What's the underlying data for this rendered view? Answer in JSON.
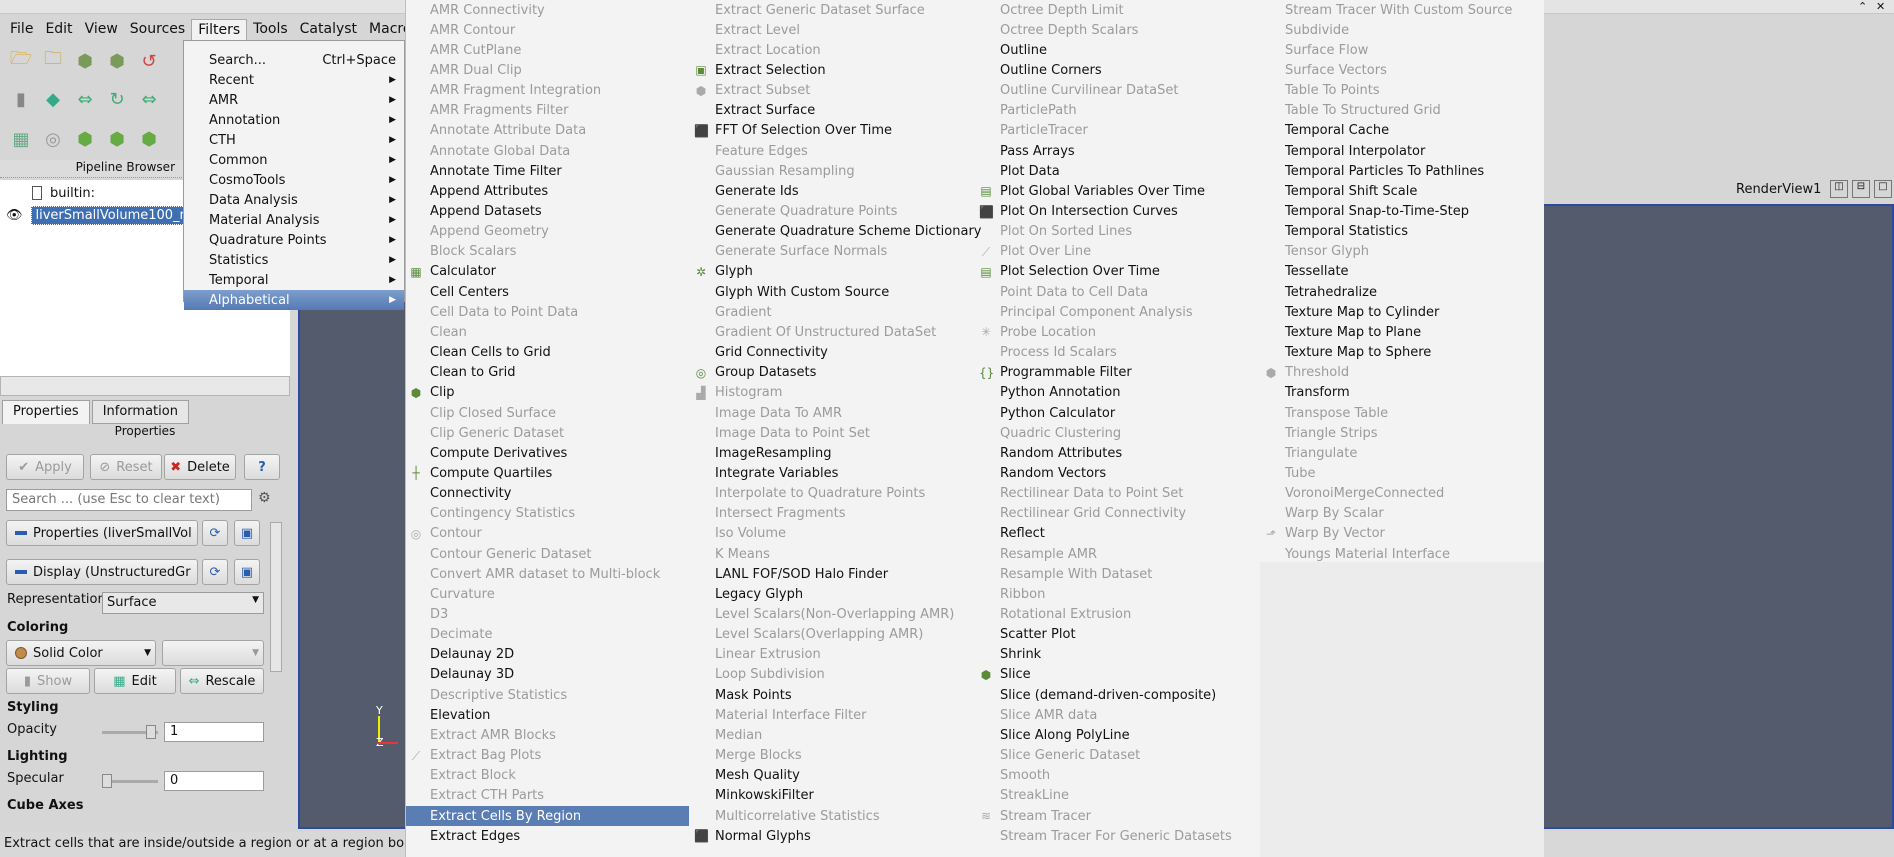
{
  "menubar": {
    "items": [
      "File",
      "Edit",
      "View",
      "Sources",
      "Filters",
      "Tools",
      "Catalyst",
      "Macros"
    ],
    "active": "Filters"
  },
  "pipeline": {
    "header": "Pipeline Browser",
    "builtin": "builtin:",
    "source": "liverSmallVolume100_n"
  },
  "properties": {
    "tabs": [
      "Properties",
      "Information"
    ],
    "title": "Properties",
    "apply": "Apply",
    "reset": "Reset",
    "delete": "Delete",
    "help": "?",
    "search_placeholder": "Search ... (use Esc to clear text)",
    "section_props": "Properties (liverSmallVol",
    "section_display": "Display (UnstructuredGr",
    "representation_label": "Representation",
    "representation_value": "Surface",
    "coloring": "Coloring",
    "solid_color": "Solid Color",
    "show": "Show",
    "edit": "Edit",
    "rescale": "Rescale",
    "styling": "Styling",
    "opacity_label": "Opacity",
    "opacity_value": "1",
    "lighting": "Lighting",
    "specular_label": "Specular",
    "specular_value": "0",
    "cube_axes": "Cube Axes"
  },
  "renderview": {
    "title": "RenderView1",
    "axis_y": "Y",
    "axis_z": "Z"
  },
  "status": "Extract cells that are inside/outside a region or at a region bounda",
  "filters_menu": [
    {
      "label": "Search...",
      "shortcut": "Ctrl+Space",
      "sub": false
    },
    {
      "label": "Recent",
      "sub": true
    },
    {
      "label": "AMR",
      "sub": true
    },
    {
      "label": "Annotation",
      "sub": true
    },
    {
      "label": "CTH",
      "sub": true
    },
    {
      "label": "Common",
      "sub": true
    },
    {
      "label": "CosmoTools",
      "sub": true
    },
    {
      "label": "Data Analysis",
      "sub": true
    },
    {
      "label": "Material Analysis",
      "sub": true
    },
    {
      "label": "Quadrature Points",
      "sub": true
    },
    {
      "label": "Statistics",
      "sub": true
    },
    {
      "label": "Temporal",
      "sub": true
    },
    {
      "label": "Alphabetical",
      "sub": true,
      "selected": true
    }
  ],
  "alphabetical": {
    "col1": [
      {
        "t": "AMR Connectivity",
        "e": false
      },
      {
        "t": "AMR Contour",
        "e": false
      },
      {
        "t": "AMR CutPlane",
        "e": false
      },
      {
        "t": "AMR Dual Clip",
        "e": false
      },
      {
        "t": "AMR Fragment Integration",
        "e": false
      },
      {
        "t": "AMR Fragments Filter",
        "e": false
      },
      {
        "t": "Annotate Attribute Data",
        "e": false
      },
      {
        "t": "Annotate Global Data",
        "e": false
      },
      {
        "t": "Annotate Time Filter",
        "e": true
      },
      {
        "t": "Append Attributes",
        "e": true
      },
      {
        "t": "Append Datasets",
        "e": true
      },
      {
        "t": "Append Geometry",
        "e": false
      },
      {
        "t": "Block Scalars",
        "e": false
      },
      {
        "t": "Calculator",
        "e": true,
        "icon": "calculator-icon"
      },
      {
        "t": "Cell Centers",
        "e": true
      },
      {
        "t": "Cell Data to Point Data",
        "e": false
      },
      {
        "t": "Clean",
        "e": false
      },
      {
        "t": "Clean Cells to Grid",
        "e": true
      },
      {
        "t": "Clean to Grid",
        "e": true
      },
      {
        "t": "Clip",
        "e": true,
        "icon": "clip-icon"
      },
      {
        "t": "Clip Closed Surface",
        "e": false
      },
      {
        "t": "Clip Generic Dataset",
        "e": false
      },
      {
        "t": "Compute Derivatives",
        "e": true
      },
      {
        "t": "Compute Quartiles",
        "e": true,
        "icon": "quartiles-icon"
      },
      {
        "t": "Connectivity",
        "e": true
      },
      {
        "t": "Contingency Statistics",
        "e": false
      },
      {
        "t": "Contour",
        "e": false,
        "icon": "contour-icon"
      },
      {
        "t": "Contour Generic Dataset",
        "e": false
      },
      {
        "t": "Convert AMR dataset to Multi-block",
        "e": false
      },
      {
        "t": "Curvature",
        "e": false
      },
      {
        "t": "D3",
        "e": false
      },
      {
        "t": "Decimate",
        "e": false
      },
      {
        "t": "Delaunay 2D",
        "e": true
      },
      {
        "t": "Delaunay 3D",
        "e": true
      },
      {
        "t": "Descriptive Statistics",
        "e": false
      },
      {
        "t": "Elevation",
        "e": true
      },
      {
        "t": "Extract AMR Blocks",
        "e": false
      },
      {
        "t": "Extract Bag Plots",
        "e": false,
        "icon": "bag-plot-icon"
      },
      {
        "t": "Extract Block",
        "e": false
      },
      {
        "t": "Extract CTH Parts",
        "e": false
      },
      {
        "t": "Extract Cells By Region",
        "e": true,
        "selected": true
      },
      {
        "t": "Extract Edges",
        "e": true
      }
    ],
    "col2": [
      {
        "t": "Extract Generic Dataset Surface",
        "e": false
      },
      {
        "t": "Extract Level",
        "e": false
      },
      {
        "t": "Extract Location",
        "e": false
      },
      {
        "t": "Extract Selection",
        "e": true,
        "icon": "extract-selection-icon"
      },
      {
        "t": "Extract Subset",
        "e": false,
        "icon": "extract-subset-icon"
      },
      {
        "t": "Extract Surface",
        "e": true
      },
      {
        "t": "FFT Of Selection Over Time",
        "e": true,
        "icon": "fft-icon"
      },
      {
        "t": "Feature Edges",
        "e": false
      },
      {
        "t": "Gaussian Resampling",
        "e": false
      },
      {
        "t": "Generate Ids",
        "e": true
      },
      {
        "t": "Generate Quadrature Points",
        "e": false
      },
      {
        "t": "Generate Quadrature Scheme Dictionary",
        "e": true
      },
      {
        "t": "Generate Surface Normals",
        "e": false
      },
      {
        "t": "Glyph",
        "e": true,
        "icon": "glyph-icon"
      },
      {
        "t": "Glyph With Custom Source",
        "e": true
      },
      {
        "t": "Gradient",
        "e": false
      },
      {
        "t": "Gradient Of Unstructured DataSet",
        "e": false
      },
      {
        "t": "Grid Connectivity",
        "e": true
      },
      {
        "t": "Group Datasets",
        "e": true,
        "icon": "group-icon"
      },
      {
        "t": "Histogram",
        "e": false,
        "icon": "histogram-icon"
      },
      {
        "t": "Image Data To AMR",
        "e": false
      },
      {
        "t": "Image Data to Point Set",
        "e": false
      },
      {
        "t": "ImageResampling",
        "e": true
      },
      {
        "t": "Integrate Variables",
        "e": true
      },
      {
        "t": "Interpolate to Quadrature Points",
        "e": false
      },
      {
        "t": "Intersect Fragments",
        "e": false
      },
      {
        "t": "Iso Volume",
        "e": false
      },
      {
        "t": "K Means",
        "e": false
      },
      {
        "t": "LANL FOF/SOD Halo Finder",
        "e": true
      },
      {
        "t": "Legacy Glyph",
        "e": true
      },
      {
        "t": "Level Scalars(Non-Overlapping AMR)",
        "e": false
      },
      {
        "t": "Level Scalars(Overlapping AMR)",
        "e": false
      },
      {
        "t": "Linear Extrusion",
        "e": false
      },
      {
        "t": "Loop Subdivision",
        "e": false
      },
      {
        "t": "Mask Points",
        "e": true
      },
      {
        "t": "Material Interface Filter",
        "e": false
      },
      {
        "t": "Median",
        "e": false
      },
      {
        "t": "Merge Blocks",
        "e": false
      },
      {
        "t": "Mesh Quality",
        "e": true
      },
      {
        "t": "MinkowskiFilter",
        "e": true
      },
      {
        "t": "Multicorrelative Statistics",
        "e": false
      },
      {
        "t": "Normal Glyphs",
        "e": true,
        "icon": "normal-glyphs-icon"
      }
    ],
    "col3": [
      {
        "t": "Octree Depth Limit",
        "e": false
      },
      {
        "t": "Octree Depth Scalars",
        "e": false
      },
      {
        "t": "Outline",
        "e": true
      },
      {
        "t": "Outline Corners",
        "e": true
      },
      {
        "t": "Outline Curvilinear DataSet",
        "e": false
      },
      {
        "t": "ParticlePath",
        "e": false
      },
      {
        "t": "ParticleTracer",
        "e": false
      },
      {
        "t": "Pass Arrays",
        "e": true
      },
      {
        "t": "Plot Data",
        "e": true
      },
      {
        "t": "Plot Global Variables Over Time",
        "e": true,
        "icon": "plot-global-icon"
      },
      {
        "t": "Plot On Intersection Curves",
        "e": true,
        "icon": "plot-intersection-icon"
      },
      {
        "t": "Plot On Sorted Lines",
        "e": false
      },
      {
        "t": "Plot Over Line",
        "e": false,
        "icon": "plot-line-icon"
      },
      {
        "t": "Plot Selection Over Time",
        "e": true,
        "icon": "plot-selection-icon"
      },
      {
        "t": "Point Data to Cell Data",
        "e": false
      },
      {
        "t": "Principal Component Analysis",
        "e": false
      },
      {
        "t": "Probe Location",
        "e": false,
        "icon": "probe-icon"
      },
      {
        "t": "Process Id Scalars",
        "e": false
      },
      {
        "t": "Programmable Filter",
        "e": true,
        "icon": "programmable-icon"
      },
      {
        "t": "Python Annotation",
        "e": true
      },
      {
        "t": "Python Calculator",
        "e": true
      },
      {
        "t": "Quadric Clustering",
        "e": false
      },
      {
        "t": "Random Attributes",
        "e": true
      },
      {
        "t": "Random Vectors",
        "e": true
      },
      {
        "t": "Rectilinear Data to Point Set",
        "e": false
      },
      {
        "t": "Rectilinear Grid Connectivity",
        "e": false
      },
      {
        "t": "Reflect",
        "e": true
      },
      {
        "t": "Resample AMR",
        "e": false
      },
      {
        "t": "Resample With Dataset",
        "e": false
      },
      {
        "t": "Ribbon",
        "e": false
      },
      {
        "t": "Rotational Extrusion",
        "e": false
      },
      {
        "t": "Scatter Plot",
        "e": true
      },
      {
        "t": "Shrink",
        "e": true
      },
      {
        "t": "Slice",
        "e": true,
        "icon": "slice-icon"
      },
      {
        "t": "Slice (demand-driven-composite)",
        "e": true
      },
      {
        "t": "Slice AMR data",
        "e": false
      },
      {
        "t": "Slice Along PolyLine",
        "e": true
      },
      {
        "t": "Slice Generic Dataset",
        "e": false
      },
      {
        "t": "Smooth",
        "e": false
      },
      {
        "t": "StreakLine",
        "e": false
      },
      {
        "t": "Stream Tracer",
        "e": false,
        "icon": "stream-tracer-icon"
      },
      {
        "t": "Stream Tracer For Generic Datasets",
        "e": false
      }
    ],
    "col4": [
      {
        "t": "Stream Tracer With Custom Source",
        "e": false
      },
      {
        "t": "Subdivide",
        "e": false
      },
      {
        "t": "Surface Flow",
        "e": false
      },
      {
        "t": "Surface Vectors",
        "e": false
      },
      {
        "t": "Table To Points",
        "e": false
      },
      {
        "t": "Table To Structured Grid",
        "e": false
      },
      {
        "t": "Temporal Cache",
        "e": true
      },
      {
        "t": "Temporal Interpolator",
        "e": true
      },
      {
        "t": "Temporal Particles To Pathlines",
        "e": true
      },
      {
        "t": "Temporal Shift Scale",
        "e": true
      },
      {
        "t": "Temporal Snap-to-Time-Step",
        "e": true
      },
      {
        "t": "Temporal Statistics",
        "e": true
      },
      {
        "t": "Tensor Glyph",
        "e": false
      },
      {
        "t": "Tessellate",
        "e": true
      },
      {
        "t": "Tetrahedralize",
        "e": true
      },
      {
        "t": "Texture Map to Cylinder",
        "e": true
      },
      {
        "t": "Texture Map to Plane",
        "e": true
      },
      {
        "t": "Texture Map to Sphere",
        "e": true
      },
      {
        "t": "Threshold",
        "e": false,
        "icon": "threshold-icon"
      },
      {
        "t": "Transform",
        "e": true
      },
      {
        "t": "Transpose Table",
        "e": false
      },
      {
        "t": "Triangle Strips",
        "e": false
      },
      {
        "t": "Triangulate",
        "e": false
      },
      {
        "t": "Tube",
        "e": false
      },
      {
        "t": "VoronoiMergeConnected",
        "e": false
      },
      {
        "t": "Warp By Scalar",
        "e": false
      },
      {
        "t": "Warp By Vector",
        "e": false,
        "icon": "warp-vector-icon"
      },
      {
        "t": "Youngs Material Interface",
        "e": false
      }
    ]
  }
}
